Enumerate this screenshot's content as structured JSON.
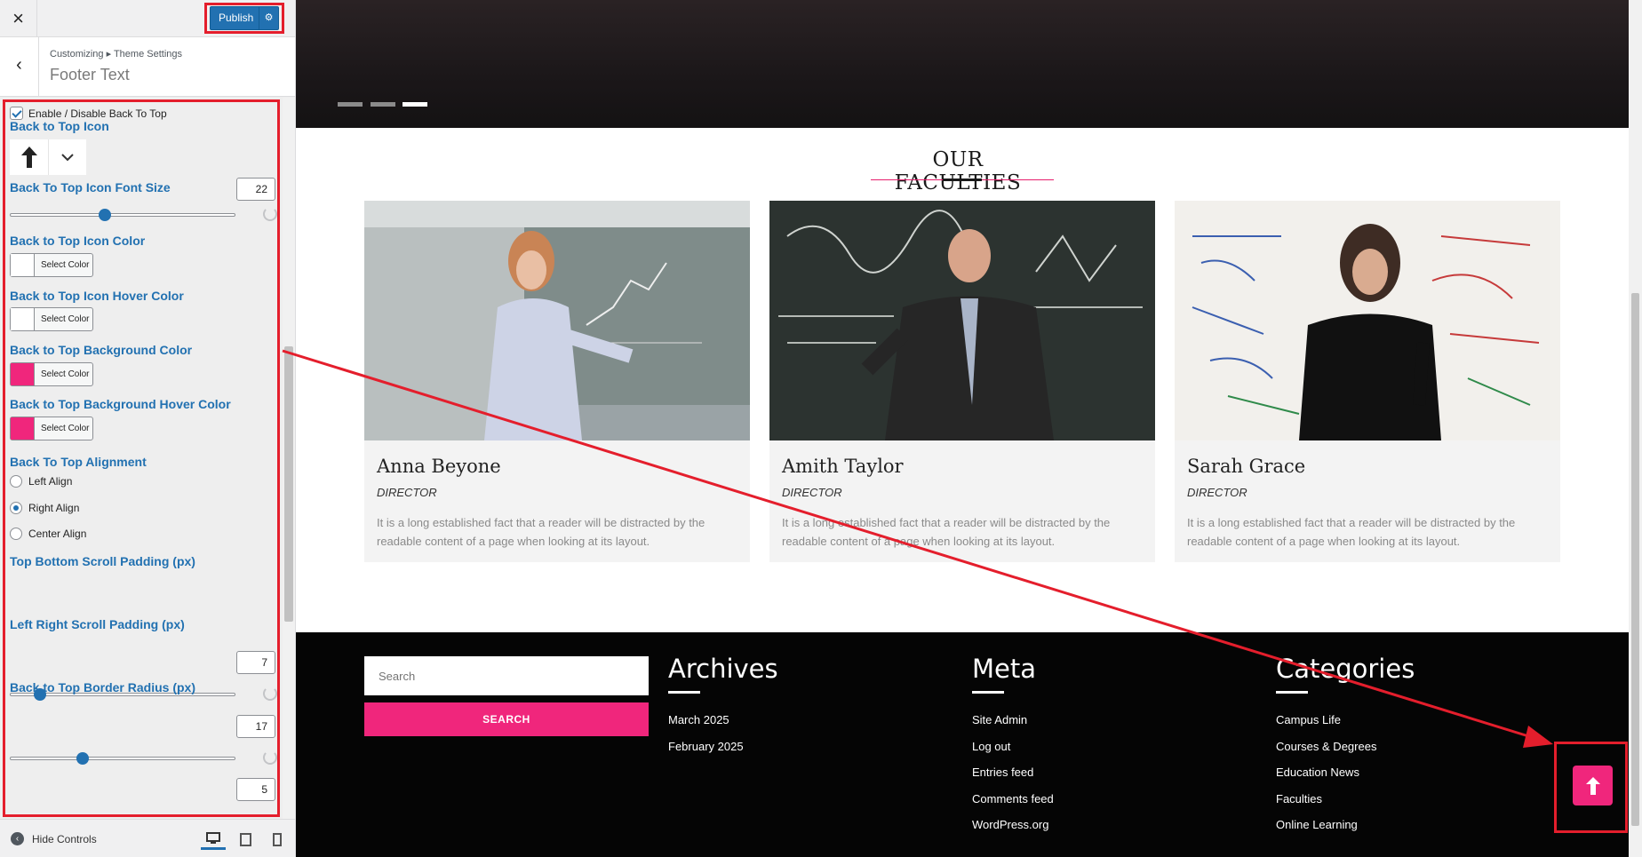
{
  "panel": {
    "close_label": "×",
    "publish_label": "Publish",
    "breadcrumb": "Customizing ▸ Theme Settings",
    "section_title": "Footer Text",
    "hide_controls": "Hide Controls"
  },
  "controls": {
    "enable_label": "Enable / Disable Back To Top",
    "enable_checked": true,
    "icon_label": "Back to Top Icon",
    "icon_name": "arrow-up-icon",
    "font_size_label": "Back To Top Icon Font Size",
    "font_size_value": "22",
    "font_size_fraction": 0.42,
    "icon_color_label": "Back to Top Icon Color",
    "icon_color": "#ffffff",
    "icon_hover_label": "Back to Top Icon Hover Color",
    "icon_hover_color": "#ffffff",
    "bg_color_label": "Back to Top Background Color",
    "bg_color": "#f0267c",
    "bg_hover_label": "Back to Top Background Hover Color",
    "bg_hover_color": "#f0267c",
    "select_color": "Select Color",
    "alignment_label": "Back To Top Alignment",
    "align_left": "Left Align",
    "align_right": "Right Align",
    "align_center": "Center Align",
    "align_selected": "Right Align",
    "tb_padding_label": "Top Bottom Scroll Padding (px)",
    "tb_padding_value": "7",
    "tb_padding_fraction": 0.13,
    "lr_padding_label": "Left Right Scroll Padding (px)",
    "lr_padding_value": "17",
    "lr_padding_fraction": 0.32,
    "radius_label": "Back to Top Border Radius (px)",
    "radius_value": "5"
  },
  "preview": {
    "section_title": "OUR FACULTIES",
    "cards": [
      {
        "name": "Anna Beyone",
        "role": "DIRECTOR",
        "desc": "It is a long established fact that a reader will be distracted by the readable content of a page when looking at its layout."
      },
      {
        "name": "Amith Taylor",
        "role": "DIRECTOR",
        "desc": "It is a long established fact that a reader will be distracted by the readable content of a page when looking at its layout."
      },
      {
        "name": "Sarah Grace",
        "role": "DIRECTOR",
        "desc": "It is a long established fact that a reader will be distracted by the readable content of a page when looking at its layout."
      }
    ],
    "footer": {
      "search_placeholder": "Search",
      "search_button": "SEARCH",
      "archives": {
        "title": "Archives",
        "links": [
          "March 2025",
          "February 2025"
        ]
      },
      "meta": {
        "title": "Meta",
        "links": [
          "Site Admin",
          "Log out",
          "Entries feed",
          "Comments feed",
          "WordPress.org"
        ]
      },
      "categories": {
        "title": "Categories",
        "links": [
          "Campus Life",
          "Courses & Degrees",
          "Education News",
          "Faculties",
          "Online Learning"
        ]
      }
    }
  },
  "colors": {
    "accent": "#f0267c",
    "admin_blue": "#2271b1",
    "annotation_red": "#e41e2c"
  }
}
